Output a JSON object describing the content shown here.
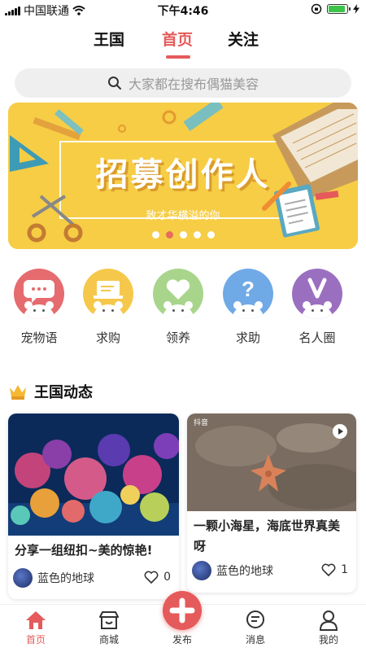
{
  "status_bar": {
    "carrier": "中国联通",
    "time": "下午4:46"
  },
  "tabs": [
    {
      "label": "王国"
    },
    {
      "label": "首页"
    },
    {
      "label": "关注"
    }
  ],
  "search": {
    "placeholder": "大家都在搜布偶猫美容"
  },
  "banner": {
    "title": "招募创作人",
    "subtitle": "致才华横溢的你",
    "active_slide": 1,
    "slide_count": 5
  },
  "categories": [
    {
      "label": "宠物语",
      "color": "#e56b6f",
      "icon": "chat-bubble-icon"
    },
    {
      "label": "求购",
      "color": "#f5c84b",
      "icon": "laptop-icon"
    },
    {
      "label": "领养",
      "color": "#a8d58b",
      "icon": "heart-icon"
    },
    {
      "label": "求助",
      "color": "#6fa9e6",
      "icon": "question-icon"
    },
    {
      "label": "名人圈",
      "color": "#9b6fc0",
      "icon": "v-badge-icon"
    }
  ],
  "section": {
    "title": "王国动态"
  },
  "posts": [
    {
      "title": "分享一组纽扣~美的惊艳!",
      "author": "蓝色的地球",
      "likes": "0",
      "is_video": false
    },
    {
      "title": "一颗小海星，海底世界真美呀",
      "author": "蓝色的地球",
      "likes": "1",
      "is_video": true,
      "watermark": "抖音"
    }
  ],
  "bottom_nav": [
    {
      "label": "首页",
      "active": true
    },
    {
      "label": "商城",
      "active": false
    },
    {
      "label": "发布",
      "active": false
    },
    {
      "label": "消息",
      "active": false
    },
    {
      "label": "我的",
      "active": false
    }
  ],
  "colors": {
    "accent": "#e55a5a",
    "banner_bg": "#f6cd45"
  }
}
